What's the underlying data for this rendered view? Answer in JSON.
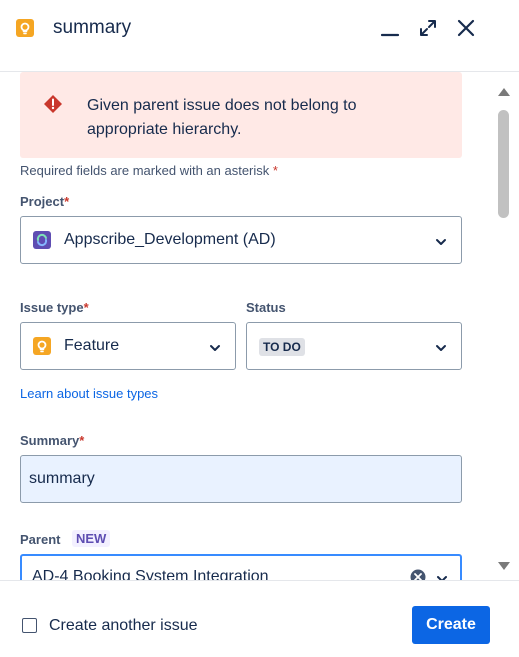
{
  "header": {
    "title": "summary",
    "feature_icon": "feature-icon",
    "minimize_icon": "minimize-icon",
    "expand_icon": "expand-icon",
    "close_icon": "close-icon"
  },
  "error": {
    "icon": "error-icon",
    "message": "Given parent issue does not belong to appropriate hierarchy."
  },
  "required_note": {
    "text": "Required fields are marked with an asterisk",
    "asterisk": "*"
  },
  "project": {
    "label": "Project",
    "value": "Appscribe_Development (AD)",
    "icon": "project-icon"
  },
  "issue_type": {
    "label": "Issue type",
    "value": "Feature",
    "icon": "feature-icon"
  },
  "status": {
    "label": "Status",
    "value": "TO DO"
  },
  "learn_link": "Learn about issue types",
  "summary": {
    "label": "Summary",
    "value": "summary"
  },
  "parent": {
    "label": "Parent",
    "badge": "NEW",
    "value": "AD-4 Booking System Integration"
  },
  "footer": {
    "checkbox_label": "Create another issue",
    "create_label": "Create"
  },
  "colors": {
    "primary": "#0c66e4",
    "error_bg": "#ffe9e6",
    "error_icon": "#c9372c",
    "feature_orange": "#f5a623",
    "project_purple": "#5e4db2",
    "new_badge": "#5e4db2"
  }
}
